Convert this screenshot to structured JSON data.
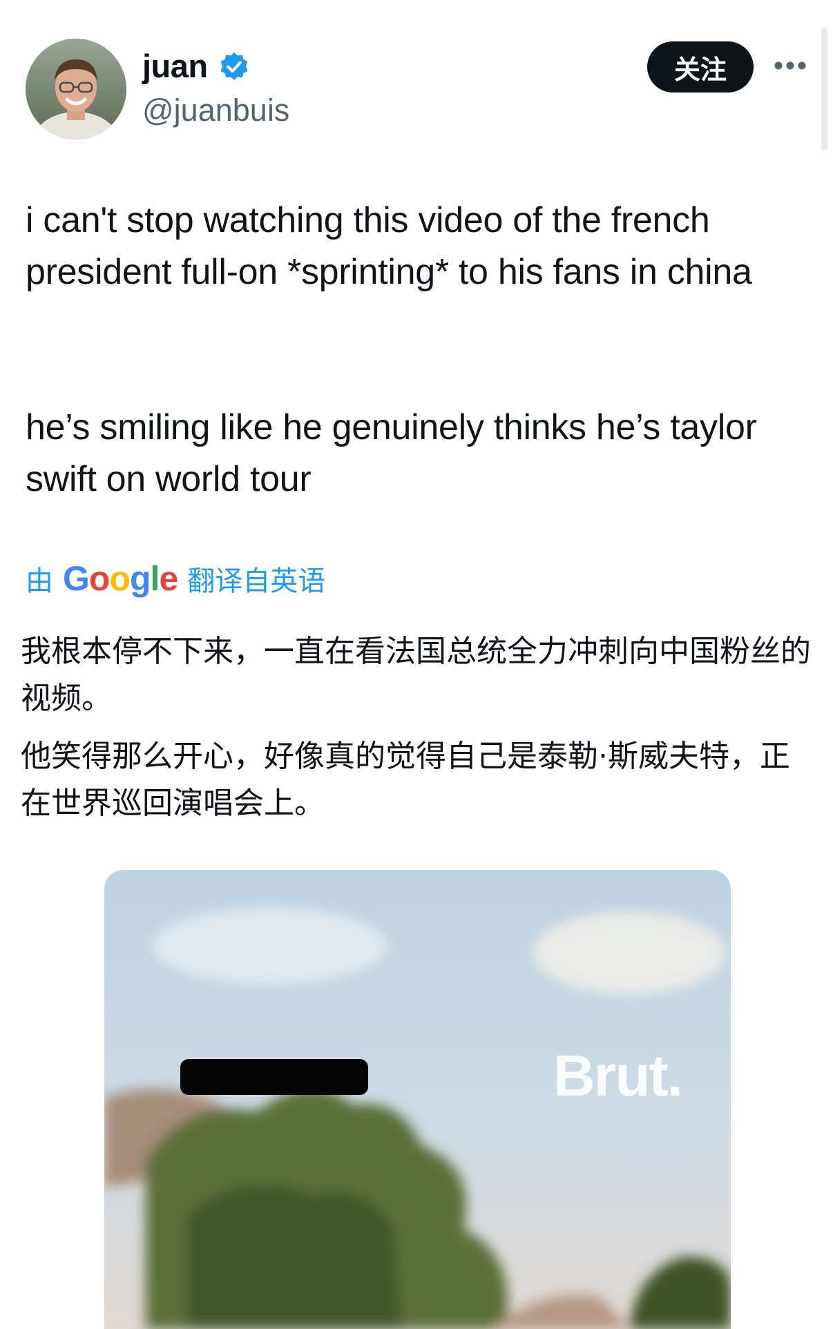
{
  "author": {
    "display_name": "juan",
    "handle": "@juanbuis",
    "verified": true
  },
  "header": {
    "follow_label": "关注"
  },
  "tweet": {
    "paragraphs": [
      "i can't stop watching this video of the french president full-on *sprinting* to his fans in china",
      "he’s smiling like he genuinely thinks he’s taylor swift on world tour"
    ]
  },
  "translation": {
    "prefix": "由",
    "provider": "Google",
    "suffix": "翻译自英语",
    "paragraphs": [
      "我根本停不下来，一直在看法国总统全力冲刺向中国粉丝的视频。",
      "他笑得那么开心，好像真的觉得自己是泰勒·斯威夫特，正在世界巡回演唱会上。"
    ]
  },
  "media": {
    "watermark": "Brut."
  },
  "icons": {
    "verified": "verified-badge-icon",
    "more": "more-options-icon"
  },
  "colors": {
    "accent": "#1d9bf0",
    "text": "#0f1419",
    "secondary_text": "#536471",
    "follow_button_bg": "#0f1419"
  }
}
